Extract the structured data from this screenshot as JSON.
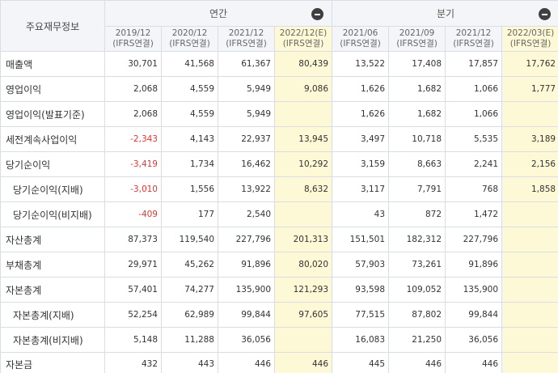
{
  "header": {
    "label": "주요재무정보",
    "annual_label": "연간",
    "quarterly_label": "분기",
    "columns": [
      {
        "period": "2019/12",
        "basis": "(IFRS연결)",
        "estimate": false
      },
      {
        "period": "2020/12",
        "basis": "(IFRS연결)",
        "estimate": false
      },
      {
        "period": "2021/12",
        "basis": "(IFRS연결)",
        "estimate": false
      },
      {
        "period": "2022/12(E)",
        "basis": "(IFRS연결)",
        "estimate": true
      },
      {
        "period": "2021/06",
        "basis": "(IFRS연결)",
        "estimate": false
      },
      {
        "period": "2021/09",
        "basis": "(IFRS연결)",
        "estimate": false
      },
      {
        "period": "2021/12",
        "basis": "(IFRS연결)",
        "estimate": false
      },
      {
        "period": "2022/03(E)",
        "basis": "(IFRS연결)",
        "estimate": true
      }
    ]
  },
  "rows": [
    {
      "label": "매출액",
      "sub": false,
      "values": [
        "30,701",
        "41,568",
        "61,367",
        "80,439",
        "13,522",
        "17,408",
        "17,857",
        "17,762"
      ]
    },
    {
      "label": "영업이익",
      "sub": false,
      "values": [
        "2,068",
        "4,559",
        "5,949",
        "9,086",
        "1,626",
        "1,682",
        "1,066",
        "1,777"
      ]
    },
    {
      "label": "영업이익(발표기준)",
      "sub": false,
      "values": [
        "2,068",
        "4,559",
        "5,949",
        "",
        "1,626",
        "1,682",
        "1,066",
        ""
      ]
    },
    {
      "label": "세전계속사업이익",
      "sub": false,
      "values": [
        "-2,343",
        "4,143",
        "22,937",
        "13,945",
        "3,497",
        "10,718",
        "5,535",
        "3,189"
      ]
    },
    {
      "label": "당기순이익",
      "sub": false,
      "values": [
        "-3,419",
        "1,734",
        "16,462",
        "10,292",
        "3,159",
        "8,663",
        "2,241",
        "2,156"
      ]
    },
    {
      "label": "당기순이익(지배)",
      "sub": true,
      "values": [
        "-3,010",
        "1,556",
        "13,922",
        "8,632",
        "3,117",
        "7,791",
        "768",
        "1,858"
      ]
    },
    {
      "label": "당기순이익(비지배)",
      "sub": true,
      "values": [
        "-409",
        "177",
        "2,540",
        "",
        "43",
        "872",
        "1,472",
        ""
      ]
    },
    {
      "label": "자산총계",
      "sub": false,
      "values": [
        "87,373",
        "119,540",
        "227,796",
        "201,313",
        "151,501",
        "182,312",
        "227,796",
        ""
      ]
    },
    {
      "label": "부채총계",
      "sub": false,
      "values": [
        "29,971",
        "45,262",
        "91,896",
        "80,020",
        "57,903",
        "73,261",
        "91,896",
        ""
      ]
    },
    {
      "label": "자본총계",
      "sub": false,
      "values": [
        "57,401",
        "74,277",
        "135,900",
        "121,293",
        "93,598",
        "109,052",
        "135,900",
        ""
      ]
    },
    {
      "label": "자본총계(지배)",
      "sub": true,
      "values": [
        "52,254",
        "62,989",
        "99,844",
        "97,605",
        "77,515",
        "87,802",
        "99,844",
        ""
      ]
    },
    {
      "label": "자본총계(비지배)",
      "sub": true,
      "values": [
        "5,148",
        "11,288",
        "36,056",
        "",
        "16,083",
        "21,250",
        "36,056",
        ""
      ]
    },
    {
      "label": "자본금",
      "sub": false,
      "values": [
        "432",
        "443",
        "446",
        "446",
        "445",
        "446",
        "446",
        ""
      ]
    }
  ],
  "icons": {
    "collapse": "minus-circle-icon"
  },
  "colors": {
    "estimate_bg": "#fdf8d6",
    "negative": "#e83131",
    "header_bg": "#f3f5f8",
    "border": "#d9dee5"
  }
}
